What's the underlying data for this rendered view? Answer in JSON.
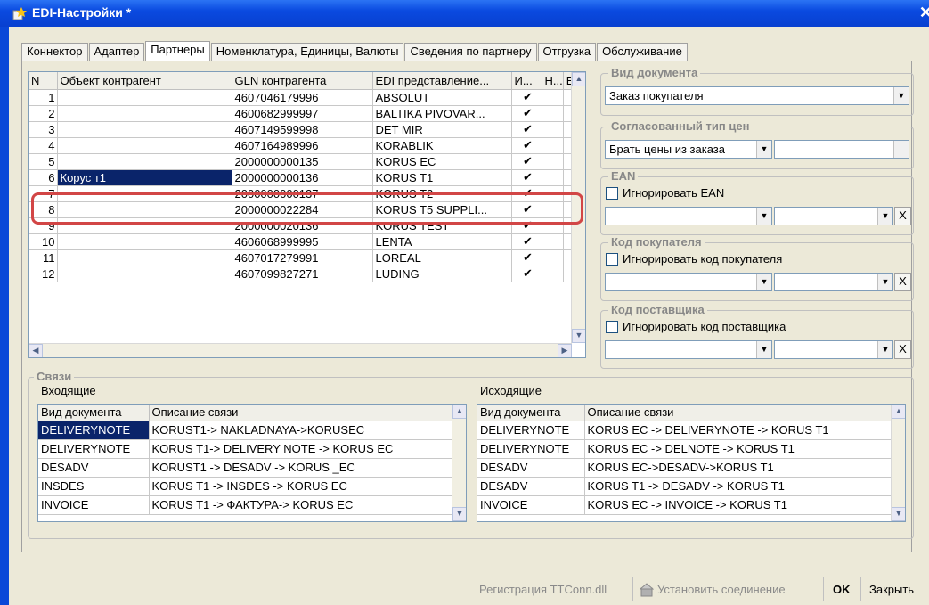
{
  "window": {
    "title": "EDI-Настройки *",
    "close_glyph": "✕"
  },
  "tabs": [
    "Коннектор",
    "Адаптер",
    "Партнеры",
    "Номенклатура, Единицы, Валюты",
    "Сведения по партнеру",
    "Отгрузка",
    "Обслуживание"
  ],
  "active_tab": "Партнеры",
  "partners_table": {
    "columns": [
      "N",
      "Объект контрагент",
      "GLN контрагента",
      "EDI представление...",
      "И...",
      "Н...",
      "E"
    ],
    "rows": [
      {
        "n": "1",
        "object": "",
        "gln": "4607046179996",
        "edi": "ABSOLUT",
        "i": "✔"
      },
      {
        "n": "2",
        "object": "",
        "gln": "4600682999997",
        "edi": "BALTIKA PIVOVAR...",
        "i": "✔"
      },
      {
        "n": "3",
        "object": "",
        "gln": "4607149599998",
        "edi": "DET MIR",
        "i": "✔"
      },
      {
        "n": "4",
        "object": "",
        "gln": "4607164989996",
        "edi": "KORABLIK",
        "i": "✔"
      },
      {
        "n": "5",
        "object": "",
        "gln": "2000000000135",
        "edi": "KORUS EC",
        "i": "✔"
      },
      {
        "n": "6",
        "object": "Корус т1",
        "gln": "2000000000136",
        "edi": "KORUS T1",
        "i": "✔"
      },
      {
        "n": "7",
        "object": "",
        "gln": "2000000000137",
        "edi": "KORUS T2",
        "i": "✔"
      },
      {
        "n": "8",
        "object": "",
        "gln": "2000000022284",
        "edi": "KORUS T5 SUPPLI...",
        "i": "✔"
      },
      {
        "n": "9",
        "object": "",
        "gln": "2000000020136",
        "edi": "KORUS TEST",
        "i": "✔"
      },
      {
        "n": "10",
        "object": "",
        "gln": "4606068999995",
        "edi": "LENTA",
        "i": "✔"
      },
      {
        "n": "11",
        "object": "",
        "gln": "4607017279991",
        "edi": "LOREAL",
        "i": "✔"
      },
      {
        "n": "12",
        "object": "",
        "gln": "4607099827271",
        "edi": "LUDING",
        "i": "✔"
      }
    ]
  },
  "doc_type": {
    "title": "Вид документа",
    "value": "Заказ покупателя"
  },
  "price_type": {
    "title": "Согласованный тип цен",
    "value": "Брать цены из заказа",
    "select_glyph": "..."
  },
  "ean": {
    "title": "EAN",
    "checkbox_label": "Игнорировать EAN",
    "clear_glyph": "X"
  },
  "buyer_code": {
    "title": "Код покупателя",
    "checkbox_label": "Игнорировать код покупателя",
    "clear_glyph": "X"
  },
  "supplier_code": {
    "title": "Код поставщика",
    "checkbox_label": "Игнорировать код поставщика",
    "clear_glyph": "X"
  },
  "links": {
    "title": "Связи",
    "incoming": {
      "label": "Входящие",
      "columns": [
        "Вид документа",
        "Описание связи"
      ],
      "rows": [
        [
          "DELIVERYNOTE",
          "KORUST1-> NAKLADNAYA->KORUSEC"
        ],
        [
          "DELIVERYNOTE",
          "KORUS T1-> DELIVERY NOTE -> KORUS EC"
        ],
        [
          "DESADV",
          "KORUST1 -> DESADV -> KORUS _EC"
        ],
        [
          "INSDES",
          "KORUS T1 -> INSDES -> KORUS EC"
        ],
        [
          "INVOICE",
          "KORUS T1 -> ФАКТУРА-> KORUS EC"
        ]
      ]
    },
    "outgoing": {
      "label": "Исходящие",
      "columns": [
        "Вид документа",
        "Описание связи"
      ],
      "rows": [
        [
          "DELIVERYNOTE",
          "KORUS EC -> DELIVERYNOTE -> KORUS T1"
        ],
        [
          "DELIVERYNOTE",
          "KORUS EC -> DELNOTE -> KORUS T1"
        ],
        [
          "DESADV",
          "KORUS EC->DESADV->KORUS T1"
        ],
        [
          "DESADV",
          "KORUS T1 -> DESADV -> KORUS T1"
        ],
        [
          "INVOICE",
          "KORUS EC -> INVOICE -> KORUS T1"
        ]
      ]
    }
  },
  "footer": {
    "register": "Регистрация TTConn.dll",
    "connect": "Установить соединение",
    "ok": "OK",
    "close": "Закрыть"
  },
  "colors": {
    "titlebar": "#0a4ae0",
    "selection": "#0a246a",
    "highlight": "#d24646"
  }
}
